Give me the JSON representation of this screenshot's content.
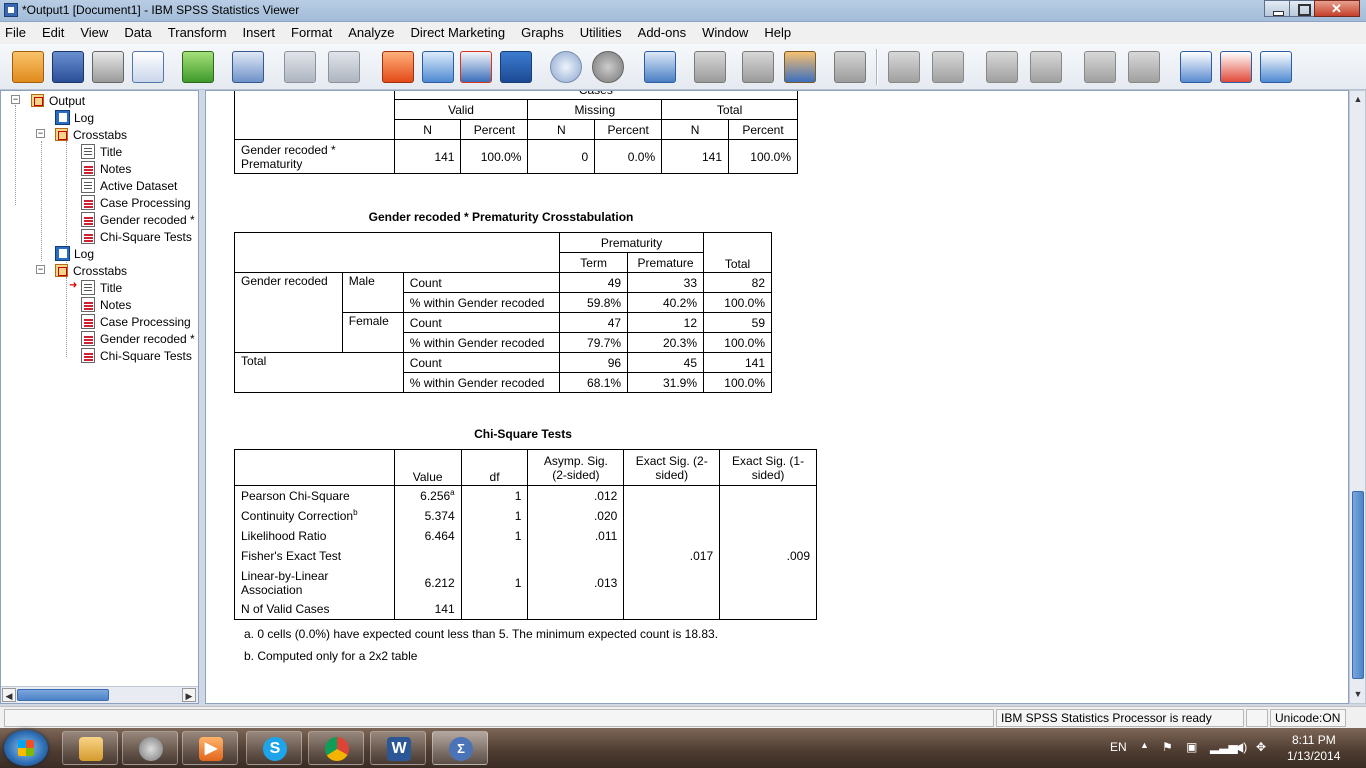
{
  "window": {
    "title": "*Output1 [Document1] - IBM SPSS Statistics Viewer"
  },
  "menu": [
    "File",
    "Edit",
    "View",
    "Data",
    "Transform",
    "Insert",
    "Format",
    "Analyze",
    "Direct Marketing",
    "Graphs",
    "Utilities",
    "Add-ons",
    "Window",
    "Help"
  ],
  "toolbar_icons": [
    "open-icon",
    "save-icon",
    "print-icon",
    "print-preview-icon",
    "export-icon",
    "recall-dialog-icon",
    "undo-icon",
    "redo-icon",
    "goto-case-icon",
    "goto-variable-icon",
    "variables-icon",
    "select-cases-icon",
    "designate-window-icon",
    "show-all-variables-icon",
    "scripting-icon",
    "outline-promote-icon",
    "outline-demote-icon",
    "outline-expand-icon",
    "outline-collapse-icon",
    "back-icon",
    "forward-icon",
    "expand-icon",
    "collapse-icon",
    "show-icon",
    "hide-icon",
    "insert-heading-icon",
    "insert-title-icon",
    "insert-text-icon"
  ],
  "tree": {
    "output": "Output",
    "log1": "Log",
    "crosstabs1": "Crosstabs",
    "c1_items": [
      "Title",
      "Notes",
      "Active Dataset",
      "Case Processing",
      "Gender recoded *",
      "Chi-Square Tests"
    ],
    "log2": "Log",
    "crosstabs2": "Crosstabs",
    "c2_items": [
      "Title",
      "Notes",
      "Case Processing",
      "Gender recoded *",
      "Chi-Square Tests"
    ]
  },
  "case_processing": {
    "header_top_partial": "Cases",
    "groups": [
      "Valid",
      "Missing",
      "Total"
    ],
    "subheads": [
      "N",
      "Percent",
      "N",
      "Percent",
      "N",
      "Percent"
    ],
    "row_label": "Gender recoded * Prematurity",
    "row_label_l1": "Gender recoded *",
    "row_label_l2": "Prematurity",
    "values": [
      "141",
      "100.0%",
      "0",
      "0.0%",
      "141",
      "100.0%"
    ]
  },
  "crosstab": {
    "title": "Gender recoded * Prematurity Crosstabulation",
    "col_group": "Prematurity",
    "cols": [
      "Term",
      "Premature"
    ],
    "total": "Total",
    "row_var": "Gender recoded",
    "male": "Male",
    "female": "Female",
    "total_row": "Total",
    "stat_count": "Count",
    "stat_pct": "% within Gender recoded",
    "male_count": [
      "49",
      "33",
      "82"
    ],
    "male_pct": [
      "59.8%",
      "40.2%",
      "100.0%"
    ],
    "female_count": [
      "47",
      "12",
      "59"
    ],
    "female_pct": [
      "79.7%",
      "20.3%",
      "100.0%"
    ],
    "total_count": [
      "96",
      "45",
      "141"
    ],
    "total_pct": [
      "68.1%",
      "31.9%",
      "100.0%"
    ]
  },
  "chisq": {
    "title": "Chi-Square Tests",
    "headers": [
      "Value",
      "df",
      "Asymp. Sig. (2-sided)",
      "Exact Sig. (2-sided)",
      "Exact Sig. (1-sided)"
    ],
    "h_value": "Value",
    "h_df": "df",
    "h_asymp_l1": "Asymp. Sig.",
    "h_asymp_l2": "(2-sided)",
    "h_exact2_l1": "Exact Sig. (2-",
    "h_exact2_l2": "sided)",
    "h_exact1_l1": "Exact Sig. (1-",
    "h_exact1_l2": "sided)",
    "rows": {
      "pearson": {
        "label": "Pearson Chi-Square",
        "sup": "a",
        "value": "6.256",
        "df": "1",
        "asymp": ".012"
      },
      "continuity": {
        "label": "Continuity Correction",
        "sup": "b",
        "value": "5.374",
        "df": "1",
        "asymp": ".020"
      },
      "likelihood": {
        "label": "Likelihood Ratio",
        "value": "6.464",
        "df": "1",
        "asymp": ".011"
      },
      "fisher": {
        "label": "Fisher's Exact Test",
        "exact2": ".017",
        "exact1": ".009"
      },
      "linear": {
        "label_l1": "Linear-by-Linear",
        "label_l2": "Association",
        "value": "6.212",
        "df": "1",
        "asymp": ".013"
      },
      "nvalid": {
        "label": "N of Valid Cases",
        "value": "141"
      }
    },
    "footnote_a": "a. 0 cells (0.0%) have expected count less than 5. The minimum expected count is 18.83.",
    "footnote_b": "b. Computed only for a 2x2 table"
  },
  "status": {
    "processor": "IBM SPSS Statistics Processor is ready",
    "unicode": "Unicode:ON"
  },
  "taskbar": {
    "lang": "EN",
    "time": "8:11 PM",
    "date": "1/13/2014"
  }
}
